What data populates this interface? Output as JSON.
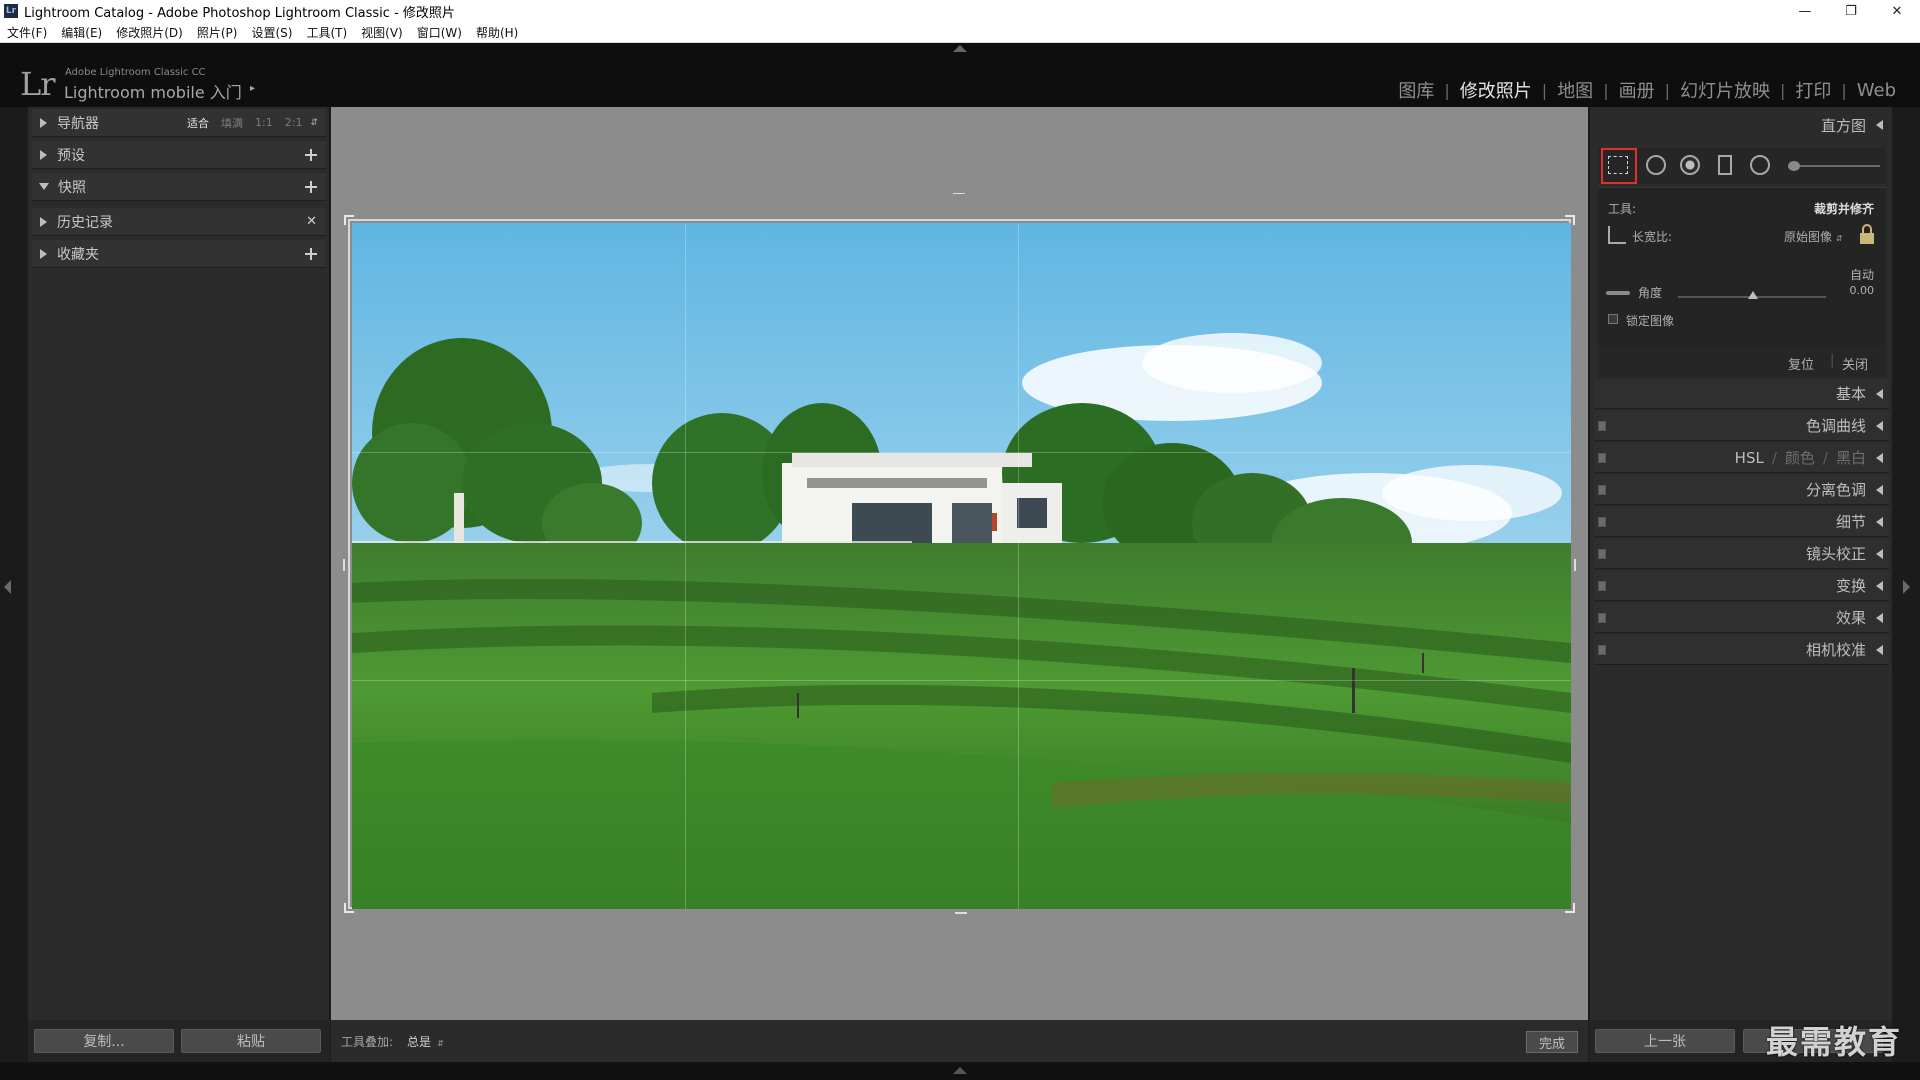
{
  "window": {
    "title": "Lightroom Catalog - Adobe Photoshop Lightroom Classic - 修改照片",
    "app_icon": "Lr"
  },
  "menu": [
    "文件(F)",
    "编辑(E)",
    "修改照片(D)",
    "照片(P)",
    "设置(S)",
    "工具(T)",
    "视图(V)",
    "窗口(W)",
    "帮助(H)"
  ],
  "identity": {
    "logo": "Lr",
    "product": "Adobe Lightroom Classic CC",
    "mobile": "Lightroom mobile 入门",
    "arrow": "▸"
  },
  "modules": [
    {
      "label": "图库",
      "active": false
    },
    {
      "label": "修改照片",
      "active": true
    },
    {
      "label": "地图",
      "active": false
    },
    {
      "label": "画册",
      "active": false
    },
    {
      "label": "幻灯片放映",
      "active": false
    },
    {
      "label": "打印",
      "active": false
    },
    {
      "label": "Web",
      "active": false
    }
  ],
  "left_panel": {
    "navigator": {
      "label": "导航器",
      "zoom_options": [
        "适合",
        "填满",
        "1:1",
        "2:1"
      ],
      "selected_zoom": "适合"
    },
    "presets": "预设",
    "snapshots": "快照",
    "history": "历史记录",
    "collections": "收藏夹",
    "copy_button": "复制...",
    "paste_button": "粘贴"
  },
  "center": {
    "tool_overlay_label": "工具叠加:",
    "tool_overlay_value": "总是",
    "done_button": "完成"
  },
  "right_panel": {
    "histogram": "直方图",
    "crop": {
      "tool_label": "工具:",
      "tool_value": "裁剪并修齐",
      "aspect_label": "长宽比:",
      "aspect_value": "原始图像",
      "auto_label": "自动",
      "angle_label": "角度",
      "angle_value": "0.00",
      "angle_fraction": 0.5,
      "constrain_label": "锁定图像",
      "reset_button": "复位",
      "close_button": "关闭"
    },
    "sections": {
      "basic": "基本",
      "tone_curve": "色调曲线",
      "hsl": "HSL",
      "color": "颜色",
      "bw": "黑白",
      "split_toning": "分离色调",
      "detail": "细节",
      "lens": "镜头校正",
      "transform": "变换",
      "effects": "效果",
      "calibration": "相机校准"
    },
    "prev_button": "上一张"
  },
  "watermark": "最需教育",
  "colors": {
    "highlight": "#e0302a",
    "panel": "#2b2b2b",
    "canvas": "#8c8c8c"
  },
  "icons": [
    "crop-overlay-icon",
    "spot-removal-icon",
    "red-eye-icon",
    "graduated-filter-icon",
    "radial-filter-icon",
    "adjustment-brush-icon",
    "straighten-tool-icon",
    "lock-icon"
  ]
}
